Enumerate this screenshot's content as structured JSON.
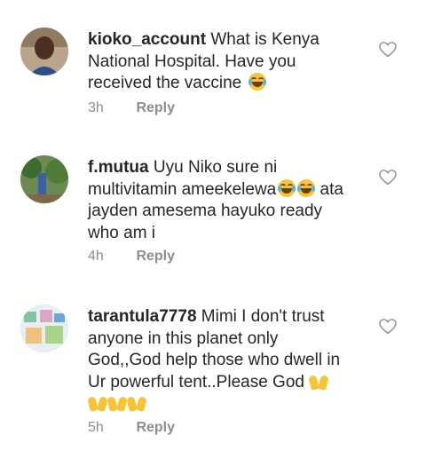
{
  "comments": [
    {
      "username": "kioko_account",
      "text": "What is Kenya National Hospital. Have you received the vaccine",
      "emoji": "face-with-tears-of-joy",
      "time": "3h",
      "reply_label": "Reply"
    },
    {
      "username": "f.mutua",
      "text": "Uyu Niko sure ni multivitamin ameekelewa",
      "text2": "ata jayden amesema hayuko ready who am i",
      "emoji": "face-with-tears-of-joy x2",
      "time": "4h",
      "reply_label": "Reply"
    },
    {
      "username": "tarantula7778",
      "text": "Mimi I don't trust anyone in this planet only God,,God help those who dwell in Ur powerful tent..Please God",
      "emoji": "raising-hands x4",
      "time": "5h",
      "reply_label": "Reply"
    }
  ],
  "colors": {
    "text": "#262626",
    "meta": "#8e8e8e",
    "background": "#ffffff"
  },
  "icons": [
    "heart-outline-icon"
  ]
}
